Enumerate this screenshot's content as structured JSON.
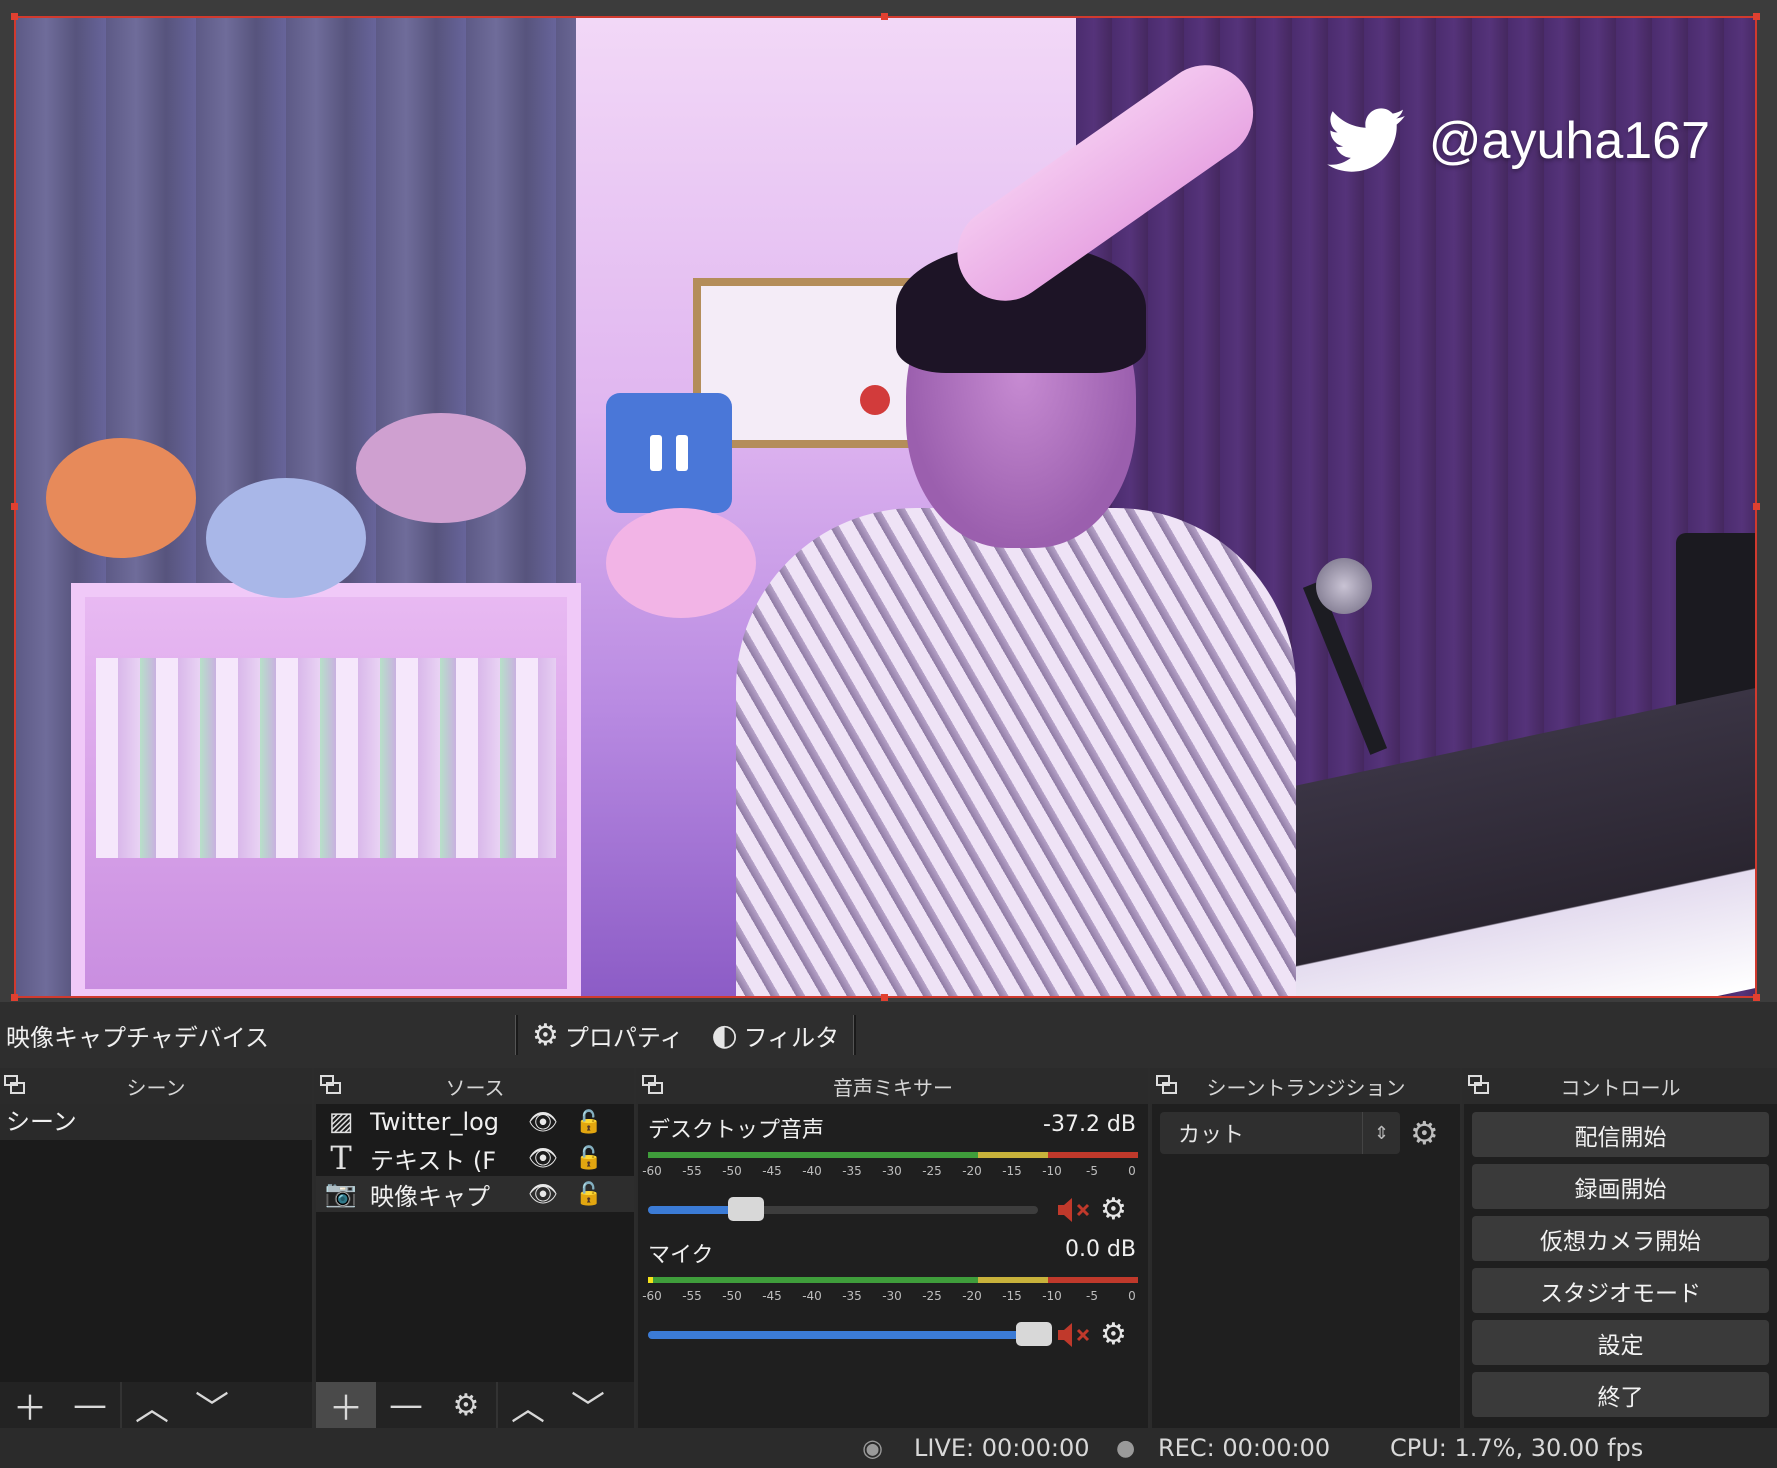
{
  "preview": {
    "overlay_handle": "@ayuha167",
    "overlay_icon": "twitter-bird-icon",
    "selection_color": "#d03a2f"
  },
  "context_bar": {
    "selected_source": "映像キャプチャデバイス",
    "properties_label": "プロパティ",
    "filters_label": "フィルタ"
  },
  "scenes": {
    "title": "シーン",
    "items": [
      "シーン"
    ]
  },
  "sources": {
    "title": "ソース",
    "items": [
      {
        "name": "Twitter_log",
        "icon": "image-icon",
        "visible": true,
        "locked": false
      },
      {
        "name": "テキスト (F",
        "icon": "text-icon",
        "visible": true,
        "locked": false
      },
      {
        "name": "映像キャプ",
        "icon": "camera-icon",
        "visible": true,
        "locked": false
      }
    ]
  },
  "mixer": {
    "title": "音声ミキサー",
    "ticks": [
      "-60",
      "-55",
      "-50",
      "-45",
      "-40",
      "-35",
      "-30",
      "-25",
      "-20",
      "-15",
      "-10",
      "-5",
      "0"
    ],
    "channels": [
      {
        "name": "デスクトップ音声",
        "db": "-37.2 dB",
        "volume": 0.25,
        "muted": true
      },
      {
        "name": "マイク",
        "db": "0.0 dB",
        "volume": 0.99,
        "muted": true
      }
    ]
  },
  "transitions": {
    "title": "シーントランジション",
    "selected": "カット"
  },
  "controls": {
    "title": "コントロール",
    "buttons": [
      "配信開始",
      "録画開始",
      "仮想カメラ開始",
      "スタジオモード",
      "設定",
      "終了"
    ]
  },
  "status": {
    "live": "LIVE: 00:00:00",
    "rec": "REC: 00:00:00",
    "cpu": "CPU: 1.7%, 30.00 fps"
  },
  "colors": {
    "accent_blue": "#3b7bd6",
    "mute_red": "#c0392b",
    "meter_green": "#3f9d3b",
    "meter_yellow": "#c8b23b"
  }
}
